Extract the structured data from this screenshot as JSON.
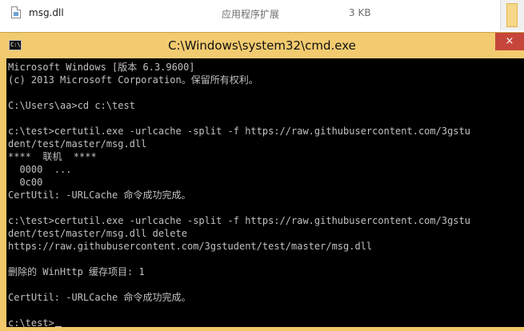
{
  "explorer": {
    "file": {
      "name": "msg.dll",
      "type": "应用程序扩展",
      "size": "3 KB"
    }
  },
  "window": {
    "title": "C:\\Windows\\system32\\cmd.exe",
    "icon": "console-icon",
    "close_glyph": "×",
    "accent_color": "#f1c86a",
    "console_color": "#000000",
    "text_color": "#c0c0c0"
  },
  "console": {
    "lines": [
      "Microsoft Windows [版本 6.3.9600]",
      "(c) 2013 Microsoft Corporation。保留所有权利。",
      "",
      "C:\\Users\\aa>cd c:\\test",
      "",
      "c:\\test>certutil.exe -urlcache -split -f https://raw.githubusercontent.com/3gstu",
      "dent/test/master/msg.dll",
      "****  联机  ****",
      "  0000  ...",
      "  0c00",
      "CertUtil: -URLCache 命令成功完成。",
      "",
      "c:\\test>certutil.exe -urlcache -split -f https://raw.githubusercontent.com/3gstu",
      "dent/test/master/msg.dll delete",
      "https://raw.githubusercontent.com/3gstudent/test/master/msg.dll",
      "",
      "删除的 WinHttp 缓存项目: 1",
      "",
      "CertUtil: -URLCache 命令成功完成。",
      "",
      "c:\\test>"
    ]
  }
}
